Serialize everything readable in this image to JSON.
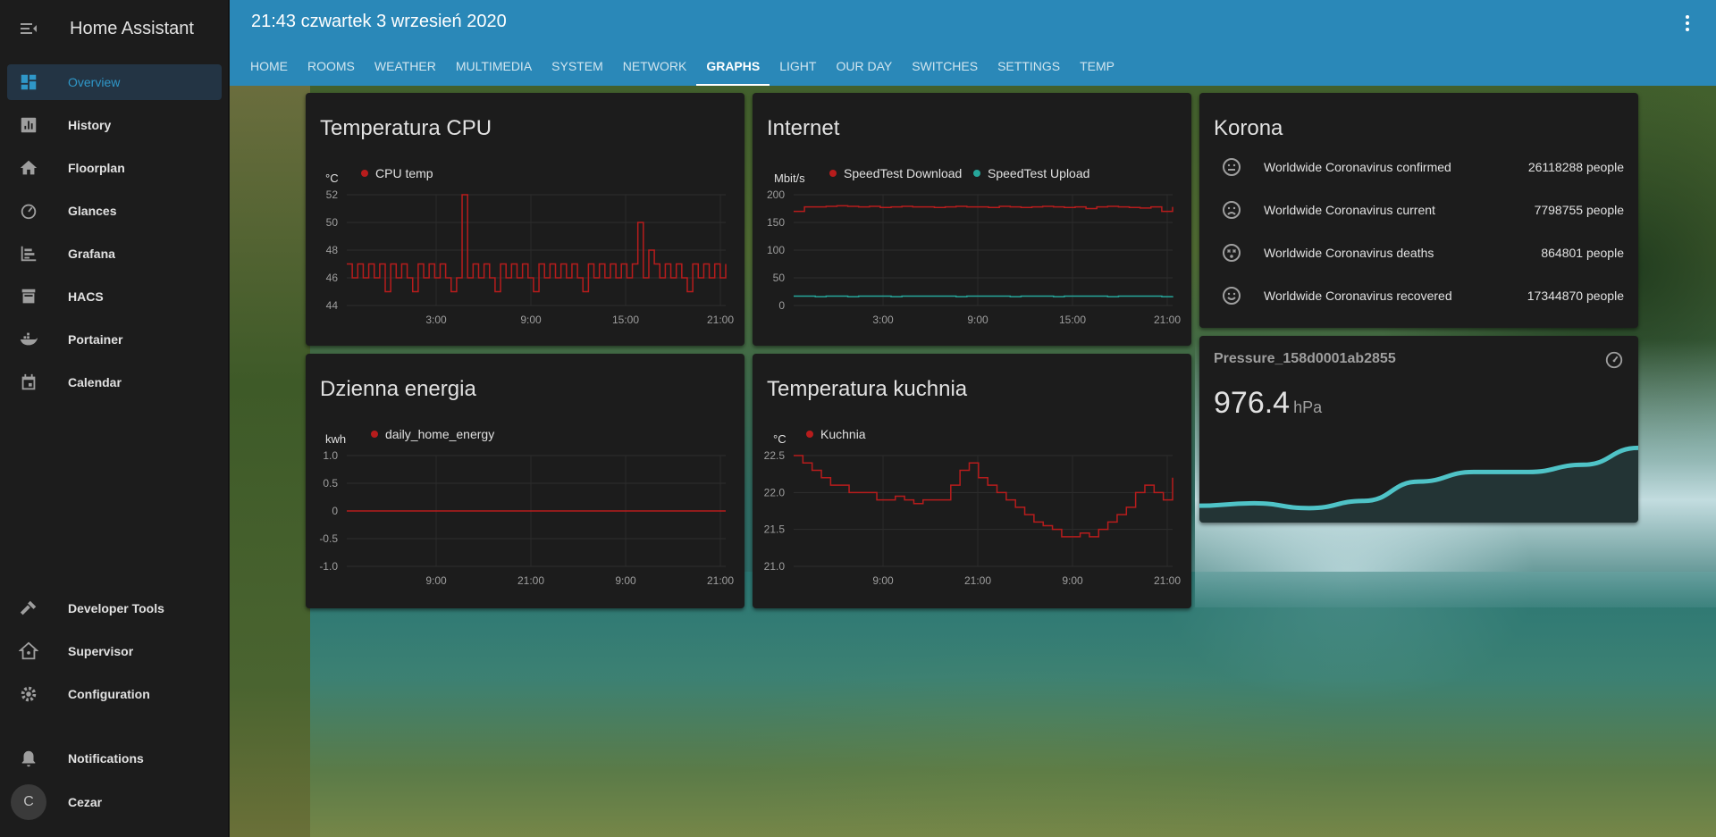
{
  "sidebar": {
    "title": "Home Assistant",
    "items": [
      {
        "label": "Overview",
        "icon": "view-dashboard-icon"
      },
      {
        "label": "History",
        "icon": "chart-box-icon"
      },
      {
        "label": "Floorplan",
        "icon": "home-icon"
      },
      {
        "label": "Glances",
        "icon": "speedometer-icon"
      },
      {
        "label": "Grafana",
        "icon": "chart-timeline-icon"
      },
      {
        "label": "HACS",
        "icon": "hacs-icon"
      },
      {
        "label": "Portainer",
        "icon": "docker-icon"
      },
      {
        "label": "Calendar",
        "icon": "calendar-icon"
      }
    ],
    "bottom": [
      {
        "label": "Developer Tools",
        "icon": "hammer-icon"
      },
      {
        "label": "Supervisor",
        "icon": "home-assistant-icon"
      },
      {
        "label": "Configuration",
        "icon": "cog-icon"
      },
      {
        "label": "Notifications",
        "icon": "bell-icon"
      }
    ],
    "user": {
      "name": "Cezar",
      "initial": "C"
    }
  },
  "header": {
    "title": "21:43 czwartek 3 wrzesień 2020",
    "tabs": [
      "HOME",
      "ROOMS",
      "WEATHER",
      "MULTIMEDIA",
      "SYSTEM",
      "NETWORK",
      "GRAPHS",
      "LIGHT",
      "OUR DAY",
      "SWITCHES",
      "SETTINGS",
      "TEMP"
    ],
    "active_tab": "GRAPHS"
  },
  "cards": {
    "cpu": {
      "title": "Temperatura CPU",
      "unit": "°C",
      "legend": "CPU temp"
    },
    "internet": {
      "title": "Internet",
      "unit": "Mbit/s",
      "legend_download": "SpeedTest Download",
      "legend_upload": "SpeedTest Upload"
    },
    "korona": {
      "title": "Korona",
      "rows": [
        {
          "name": "Worldwide Coronavirus confirmed",
          "value": "26118288 people",
          "icon": "emoticon-neutral-icon"
        },
        {
          "name": "Worldwide Coronavirus current",
          "value": "7798755 people",
          "icon": "emoticon-sad-icon"
        },
        {
          "name": "Worldwide Coronavirus deaths",
          "value": "864801 people",
          "icon": "emoticon-dead-icon"
        },
        {
          "name": "Worldwide Coronavirus recovered",
          "value": "17344870 people",
          "icon": "emoticon-happy-icon"
        }
      ]
    },
    "energy": {
      "title": "Dzienna energia",
      "unit": "kwh",
      "legend": "daily_home_energy"
    },
    "kitchen": {
      "title": "Temperatura kuchnia",
      "unit": "°C",
      "legend": "Kuchnia"
    },
    "pressure": {
      "name": "Pressure_158d0001ab2855",
      "value": "976.4",
      "unit": "hPa",
      "icon": "gauge-icon"
    }
  },
  "colors": {
    "accent": "#2a88b8",
    "series_red": "#b71c1c",
    "series_teal": "#26a69a",
    "sparkline": "#4fc3c7"
  },
  "chart_data": [
    {
      "type": "line",
      "title": "Temperatura CPU",
      "ylabel": "°C",
      "ylim": [
        44,
        52
      ],
      "yticks": [
        "52",
        "50",
        "48",
        "46",
        "44"
      ],
      "xticks": [
        "3:00",
        "9:00",
        "15:00",
        "21:00"
      ],
      "series": [
        {
          "name": "CPU temp",
          "values": [
            47,
            46,
            47,
            46,
            47,
            46,
            47,
            45,
            47,
            46,
            47,
            46,
            45,
            47,
            46,
            47,
            46,
            47,
            46,
            45,
            46,
            52,
            46,
            47,
            46,
            47,
            46,
            45,
            47,
            46,
            47,
            46,
            47,
            46,
            45,
            47,
            46,
            47,
            46,
            47,
            46,
            47,
            46,
            45,
            47,
            46,
            47,
            46,
            47,
            46,
            47,
            46,
            47,
            50,
            46,
            48,
            47,
            46,
            47,
            46,
            47,
            46,
            45,
            47,
            46,
            47,
            46,
            47,
            46,
            47
          ]
        }
      ]
    },
    {
      "type": "line",
      "title": "Internet",
      "ylabel": "Mbit/s",
      "ylim": [
        0,
        200
      ],
      "yticks": [
        "200",
        "150",
        "100",
        "50",
        "0"
      ],
      "xticks": [
        "3:00",
        "9:00",
        "15:00",
        "21:00"
      ],
      "series": [
        {
          "name": "SpeedTest Download",
          "values": [
            170,
            178,
            178,
            179,
            180,
            179,
            178,
            179,
            177,
            178,
            179,
            178,
            178,
            177,
            178,
            179,
            178,
            178,
            177,
            179,
            178,
            177,
            178,
            179,
            178,
            177,
            178,
            175,
            178,
            179,
            178,
            177,
            176,
            178,
            170,
            178
          ]
        },
        {
          "name": "SpeedTest Upload",
          "values": [
            17,
            17,
            16,
            17,
            17,
            16,
            17,
            17,
            17,
            16,
            17,
            17,
            17,
            17,
            17,
            16,
            17,
            17,
            17,
            17,
            16,
            17,
            17,
            17,
            16,
            17,
            17,
            17,
            17,
            16,
            17,
            17,
            17,
            17,
            16,
            17
          ]
        }
      ]
    },
    {
      "type": "line",
      "title": "Dzienna energia",
      "ylabel": "kwh",
      "ylim": [
        -1.0,
        1.0
      ],
      "yticks": [
        "1.0",
        "0.5",
        "0",
        "-0.5",
        "-1.0"
      ],
      "xticks": [
        "9:00",
        "21:00",
        "9:00",
        "21:00"
      ],
      "series": [
        {
          "name": "daily_home_energy",
          "values": [
            0,
            0
          ]
        }
      ]
    },
    {
      "type": "line",
      "title": "Temperatura kuchnia",
      "ylabel": "°C",
      "ylim": [
        21.0,
        22.5
      ],
      "yticks": [
        "22.5",
        "22.0",
        "21.5",
        "21.0"
      ],
      "xticks": [
        "9:00",
        "21:00",
        "9:00",
        "21:00"
      ],
      "series": [
        {
          "name": "Kuchnia",
          "values": [
            22.5,
            22.4,
            22.3,
            22.2,
            22.1,
            22.1,
            22.0,
            22.0,
            22.0,
            21.9,
            21.9,
            21.95,
            21.9,
            21.85,
            21.9,
            21.9,
            21.9,
            22.1,
            22.3,
            22.4,
            22.2,
            22.1,
            22.0,
            21.9,
            21.8,
            21.7,
            21.6,
            21.55,
            21.5,
            21.4,
            21.4,
            21.45,
            21.4,
            21.5,
            21.6,
            21.7,
            21.8,
            22.0,
            22.1,
            22.0,
            21.9,
            22.2
          ]
        }
      ]
    },
    {
      "type": "area",
      "title": "Pressure_158d0001ab2855",
      "series": [
        {
          "name": "Pressure_158d0001ab2855",
          "values": [
            974.6,
            974.7,
            974.5,
            974.8,
            975.6,
            976.0,
            976.0,
            976.3,
            977.0
          ]
        }
      ]
    }
  ]
}
